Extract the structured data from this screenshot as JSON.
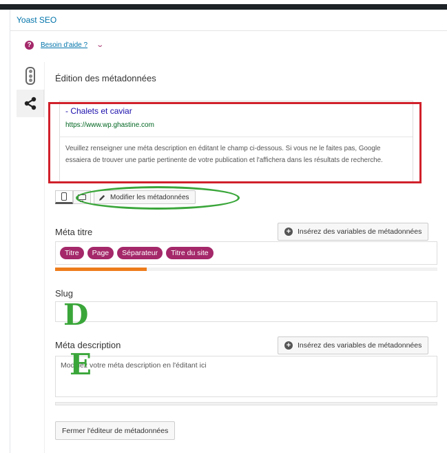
{
  "panel": {
    "title": "Yoast SEO"
  },
  "help": {
    "icon": "question-circle-icon",
    "label": "Besoin d'aide ?"
  },
  "section": {
    "heading": "Édition des métadonnées"
  },
  "snippet": {
    "title": "- Chalets et caviar",
    "url": "https://www.wp.ghastine.com",
    "description": "Veuillez renseigner une méta description en éditant le champ ci-dessous. Si vous ne le faites pas, Google essaiera de trouver une partie pertinente de votre publication et l'affichera dans les résultats de recherche."
  },
  "preview": {
    "edit_label": "Modifier les métadonnées",
    "active_mode": "mobile"
  },
  "meta_title": {
    "label": "Méta titre",
    "insert_label": "Insérez des variables de métadonnées",
    "pills": [
      "Titre",
      "Page",
      "Séparateur",
      "Titre du site"
    ],
    "progress_fraction": 0.24
  },
  "slug": {
    "label": "Slug",
    "value": ""
  },
  "meta_description": {
    "label": "Méta description",
    "insert_label": "Insérez des variables de métadonnées",
    "placeholder": "Modifiez votre méta description en l'éditant ici",
    "progress_fraction": 0
  },
  "annotations": {
    "slug_letter": "D",
    "description_letter": "E"
  },
  "close_label": "Fermer l'éditeur de métadonnées",
  "colors": {
    "accent": "#a4286a",
    "link": "#0073aa",
    "snippet_title": "#1a0dab",
    "snippet_url": "#006621",
    "progress": "#ee7c1b",
    "highlight_red": "#d0202a",
    "highlight_green": "#3aa63a"
  }
}
